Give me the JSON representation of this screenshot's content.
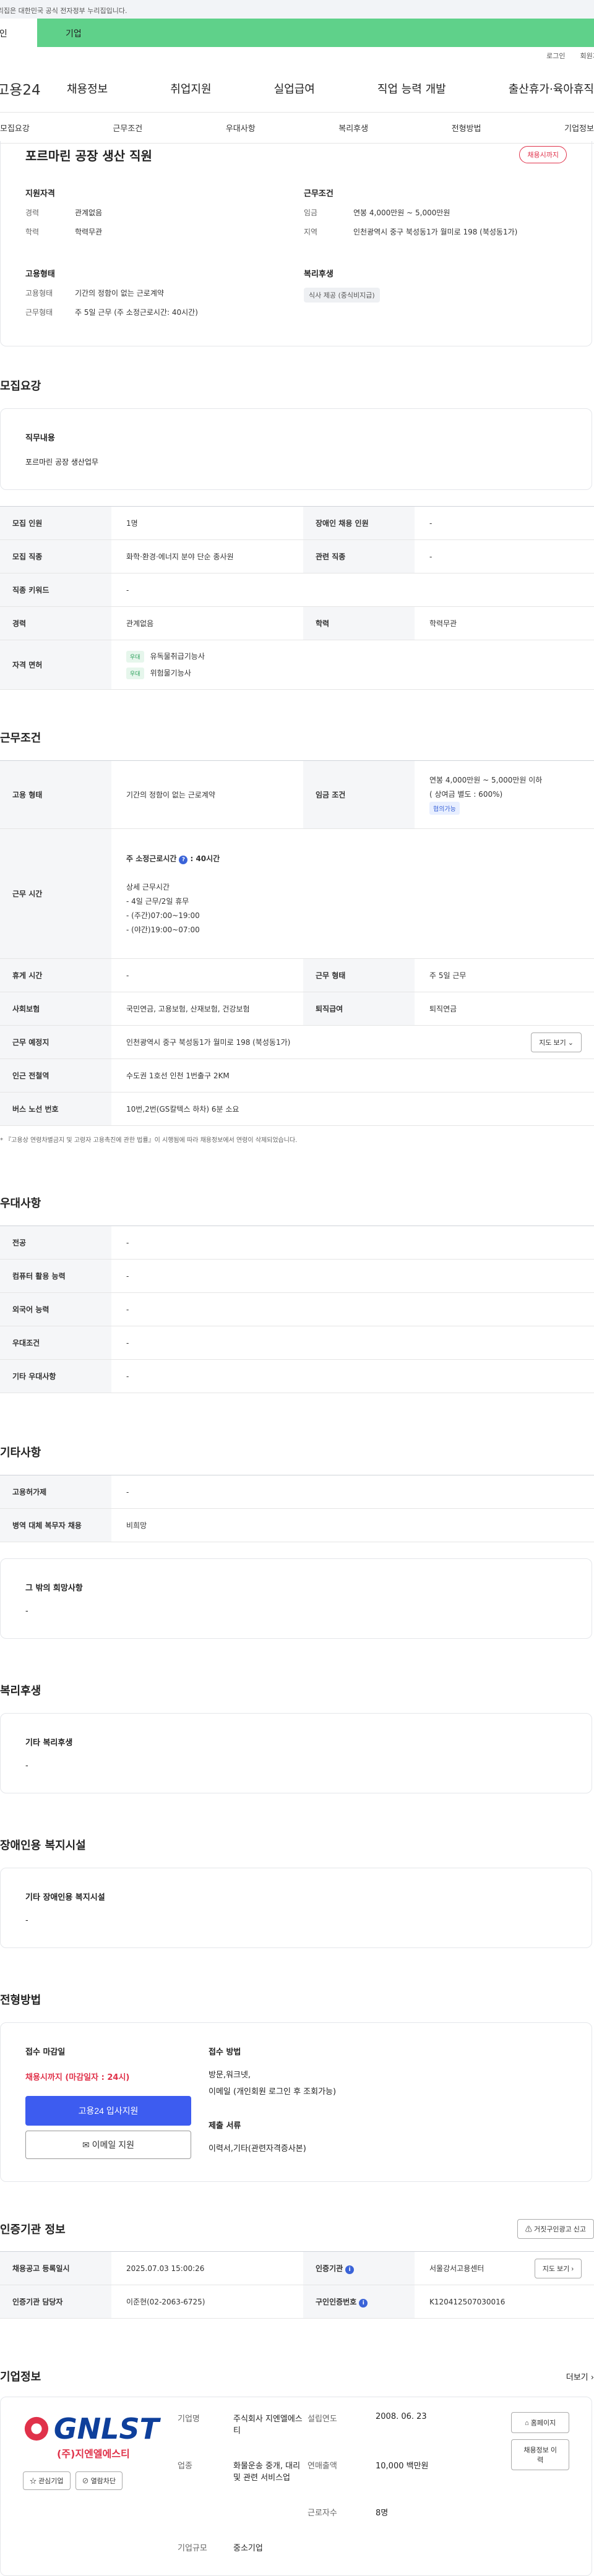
{
  "banner": "이 누리집은 대한민국 공식 전자정부 누리집입니다.",
  "tabs": [
    "개인",
    "기업"
  ],
  "util": [
    "로그인",
    "회원가입"
  ],
  "logo": "고용24",
  "gnb": [
    "채용정보",
    "취업지원",
    "실업급여",
    "직업 능력 개발",
    "출산휴가·육아휴직"
  ],
  "snb": [
    "모집요강",
    "근무조건",
    "우대사항",
    "복리후생",
    "전형방법",
    "기업정보"
  ],
  "summary": {
    "title": "포르마린 공장 생산 직원",
    "badge": "채용시까지",
    "req_title": "지원자격",
    "career_k": "경력",
    "career_v": "관계없음",
    "edu_k": "학력",
    "edu_v": "학력무관",
    "cond_title": "근무조건",
    "wage_k": "임금",
    "wage_v": "연봉 4,000만원 ~ 5,000만원",
    "area_k": "지역",
    "area_v": "인천광역시 중구 북성동1가 월미로 198 (북성동1가)",
    "emp_title": "고용형태",
    "emptype_k": "고용형태",
    "emptype_v": "기간의 정함이 없는 근로계약",
    "worktype_k": "근무형태",
    "worktype_v": "주 5일 근무 (주 소정근로시간: 40시간)",
    "welfare_title": "복리후생",
    "welfare_chip": "식사 제공 (중식비지급)"
  },
  "recruit": {
    "title": "모집요강",
    "duty_label": "직무내용",
    "duty_value": "포르마린 공장 생산업무",
    "rows": [
      {
        "k1": "모집 인원",
        "v1": "1명",
        "k2": "장애인 채용 인원",
        "v2": "-"
      },
      {
        "k1": "모집 직종",
        "v1": "화학·환경·에너지 분야 단순 종사원",
        "k2": "관련 직종",
        "v2": "-"
      },
      {
        "k1": "직종 키워드",
        "v1": "-"
      },
      {
        "k1": "경력",
        "v1": "관계없음",
        "k2": "학력",
        "v2": "학력무관"
      }
    ],
    "license_label": "자격 면허",
    "lic_tag": "우대",
    "licenses": [
      "유독물취급기능사",
      "위험물기능사"
    ]
  },
  "work": {
    "title": "근무조건",
    "emp_k": "고용 형태",
    "emp_v": "기간의 정함이 없는 근로계약",
    "wage_k": "임금 조건",
    "wage_v": "연봉 4,000만원 ~ 5,000만원 이하",
    "wage_v2": "( 상여금 별도 : 600%)",
    "wage_tag": "협의가능",
    "hours_k": "근무 시간",
    "hours_main": "주 소정근로시간",
    "hours_main_v": ": 40시간",
    "hours_detail_title": "상세 근무시간",
    "hours_lines": [
      "- 4일 근무/2일 휴무",
      "- (주간)07:00~19:00",
      "- (야간)19:00~07:00"
    ],
    "rest_k": "휴게 시간",
    "rest_v": "-",
    "form_k": "근무 형태",
    "form_v": "주 5일 근무",
    "ins_k": "사회보험",
    "ins_v": "국민연금, 고용보험, 산재보험, 건강보험",
    "ret_k": "퇴직급여",
    "ret_v": "퇴직연금",
    "place_k": "근무 예정지",
    "place_v": "인천광역시 중구 북성동1가 월미로 198 (북성동1가)",
    "map_btn": "지도 보기",
    "subway_k": "인근 전철역",
    "subway_v": "수도권 1호선 인천 1번출구 2KM",
    "bus_k": "버스 노선 번호",
    "bus_v": "10번,2번(GS칼텍스 하차) 6분 소요",
    "note": "* 『고용상 연령차별금지 및 고령자 고용촉진에 관한 법률』이 시행됨에 따라 채용정보에서 연령이 삭제되었습니다."
  },
  "pref": {
    "title": "우대사항",
    "rows": [
      {
        "k": "전공",
        "v": "-"
      },
      {
        "k": "컴퓨터 활용 능력",
        "v": "-"
      },
      {
        "k": "외국어 능력",
        "v": "-"
      },
      {
        "k": "우대조건",
        "v": "-"
      },
      {
        "k": "기타 우대사항",
        "v": "-"
      }
    ]
  },
  "etc": {
    "title": "기타사항",
    "rows": [
      {
        "k": "고용허가제",
        "v": "-"
      },
      {
        "k": "병역 대체 복무자 채용",
        "v": "비희망"
      }
    ],
    "box_label": "그 밖의 희망사항",
    "box_value": "-"
  },
  "welfare": {
    "title": "복리후생",
    "label": "기타 복리후생",
    "value": "-"
  },
  "disabled": {
    "title": "장애인용 복지시설",
    "label": "기타 장애인용 복지시설",
    "value": "-"
  },
  "selection": {
    "title": "전형방법",
    "deadline_label": "접수 마감일",
    "deadline_value": "채용시까지 (마감일자 : 24시)",
    "apply_btn": "고용24 입사지원",
    "mail_btn": "이메일 지원",
    "method_label": "접수 방법",
    "method_value": "방문,워크넷,",
    "method_value2": "이메일 (개인회원 로그인 후 조회가능)",
    "docs_label": "제출 서류",
    "docs_value": "이력서,기타(관련자격증사본)"
  },
  "agency": {
    "title": "인증기관 정보",
    "report_btn": "거짓구인광고 신고",
    "reg_k": "채용공고 등록일시",
    "reg_v": "2025.07.03 15:00:26",
    "org_k": "인증기관",
    "org_v": "서울강서고용센터",
    "map_btn": "지도 보기",
    "mgr_k": "인증기관 담당자",
    "mgr_v": "이준현(02-2063-6725)",
    "id_k": "구인인증번호",
    "id_v": "K120412507030016"
  },
  "company": {
    "title": "기업정보",
    "more": "더보기",
    "logo_main": "GNLST",
    "logo_sub": "(주)지엔엘에스티",
    "fav_btn": "관심기업",
    "block_btn": "열람차단",
    "name_k": "기업명",
    "name_v": "주식회사 지엔엘에스티",
    "est_k": "설립연도",
    "est_v": "2008. 06. 23",
    "ind_k": "업종",
    "ind_v": "화물운송 중개, 대리 및 관련 서비스업",
    "rev_k": "연매출액",
    "rev_v": "10,000 백만원",
    "emp_k": "근로자수",
    "emp_v": "8명",
    "size_k": "기업규모",
    "size_v": "중소기업",
    "home_btn": "홈페이지",
    "jobs_btn": "채용정보 이력"
  }
}
